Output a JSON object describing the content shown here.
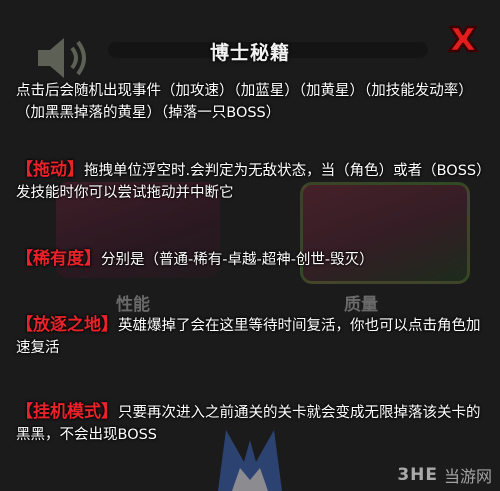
{
  "title": "博士秘籍",
  "background": {
    "card_left_label": "性能",
    "card_right_label": "质量"
  },
  "sections": [
    {
      "keyword": "",
      "text": "点击后会随机出现事件（加攻速）（加蓝星）（加黄星）（加技能发动率）（加黑黑掉落的黄星）（掉落一只BOSS）"
    },
    {
      "keyword": "【拖动】",
      "text": "拖拽单位浮空时.会判定为无敌状态，当（角色）或者（BOSS）发技能时你可以尝试拖动并中断它"
    },
    {
      "keyword": "【稀有度】",
      "text": "分别是（普通-稀有-卓越-超神-创世-毁灭）"
    },
    {
      "keyword": "【放逐之地】",
      "text": "英雄爆掉了会在这里等待时间复活，你也可以点击角色加速复活"
    },
    {
      "keyword": "【挂机模式】",
      "text": "只要再次进入之前通关的关卡就会变成无限掉落该关卡的黑黑，不会出现BOSS"
    }
  ],
  "watermark": {
    "logo": "3HE",
    "text": "当游网"
  },
  "colors": {
    "keyword": "#e8232a",
    "close": "#e01e1e",
    "text": "#ffffff"
  },
  "icons": {
    "close": "close-x-icon",
    "speaker": "speaker-icon"
  }
}
